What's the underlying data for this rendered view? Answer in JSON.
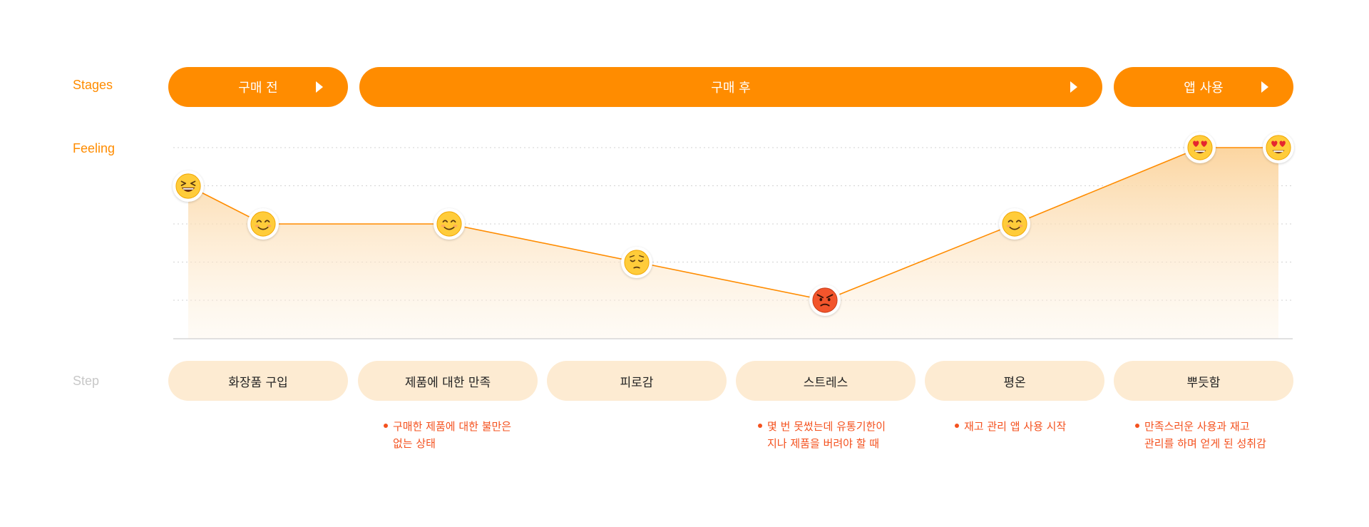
{
  "labels": {
    "stages": "Stages",
    "feeling": "Feeling",
    "step": "Step"
  },
  "stages": [
    {
      "label": "구매 전"
    },
    {
      "label": "구매 후"
    },
    {
      "label": "앱 사용"
    }
  ],
  "steps": [
    {
      "label": "화장품 구입"
    },
    {
      "label": "제품에 대한 만족"
    },
    {
      "label": "피로감"
    },
    {
      "label": "스트레스"
    },
    {
      "label": "평온"
    },
    {
      "label": "뿌듯함"
    }
  ],
  "notes": [
    {
      "line1": "구매한 제품에 대한 불만은",
      "line2": "없는 상태"
    },
    {
      "line1": "몇 번 못썼는데 유통기한이",
      "line2": "지나 제품을 버려야 할 때"
    },
    {
      "line1": "재고 관리 앱 사용 시작",
      "line2": ""
    },
    {
      "line1": "만족스러운 사용과 재고",
      "line2": "관리를 하며 얻게 된 성취감"
    }
  ],
  "chart_data": {
    "type": "line",
    "levels": 5,
    "grid": true,
    "points": [
      {
        "level": 4,
        "emoji": "laughing-face"
      },
      {
        "level": 3,
        "emoji": "smiling-face"
      },
      {
        "level": 3,
        "emoji": "smiling-face"
      },
      {
        "level": 2,
        "emoji": "pensive-face"
      },
      {
        "level": 1,
        "emoji": "angry-face"
      },
      {
        "level": 3,
        "emoji": "smiling-face"
      },
      {
        "level": 5,
        "emoji": "heart-eyes-face"
      },
      {
        "level": 5,
        "emoji": "heart-eyes-face"
      }
    ]
  },
  "colors": {
    "accent": "#ff8c00",
    "step_bg": "#fdebd2",
    "note_text": "#f4511e",
    "muted_label": "#c8c8c8"
  }
}
